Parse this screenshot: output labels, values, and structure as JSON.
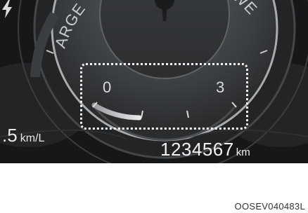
{
  "cluster": {
    "left_label": "ARGE",
    "right_label": "POWE",
    "gauge_min": "0",
    "gauge_max": "3",
    "gauge_icon": "lightning-bolt-icon",
    "fuel_economy": {
      "value": ".5",
      "unit": "km/L"
    },
    "odometer": {
      "value": "1234567",
      "unit": "km"
    }
  },
  "image_code": "OOSEV040483L",
  "colors": {
    "background": "#161718",
    "gauge_marks": "#d8dadc",
    "highlight_box": "#f4f4f4"
  }
}
